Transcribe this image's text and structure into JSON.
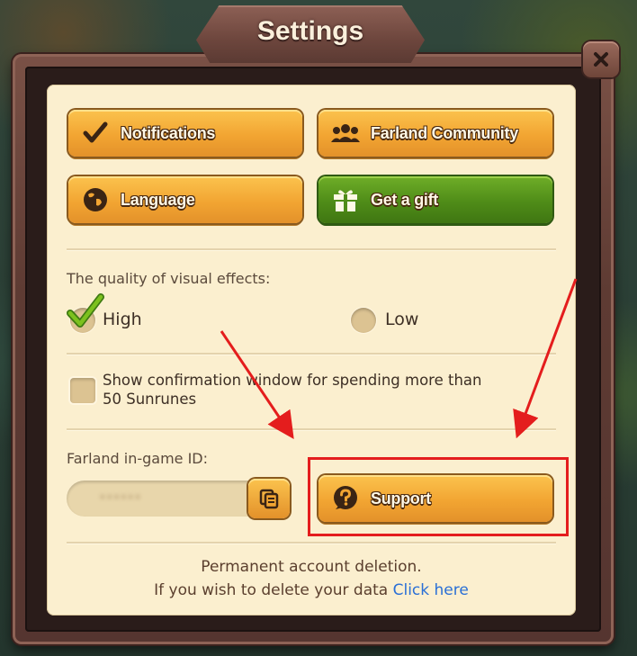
{
  "dialog": {
    "title": "Settings"
  },
  "buttons": {
    "notifications": "Notifications",
    "community": "Farland Community",
    "language": "Language",
    "gift": "Get a gift",
    "support": "Support"
  },
  "visual_quality": {
    "label": "The quality of visual effects:",
    "options": [
      "High",
      "Low"
    ],
    "selected": "High"
  },
  "confirmation": {
    "line1": "Show confirmation window for spending more than",
    "line2": "50 Sunrunes",
    "checked": false
  },
  "game_id": {
    "label": "Farland in-game ID:"
  },
  "footer": {
    "line1": "Permanent account deletion.",
    "line2_prefix": "If you wish to delete your data ",
    "link": "Click here"
  },
  "icons": {
    "close": "close-icon",
    "notifications": "checkmark-icon",
    "community": "people-icon",
    "language": "globe-icon",
    "gift": "gift-icon",
    "copy": "copy-icon",
    "support": "question-icon"
  },
  "colors": {
    "button_orange": "#f2a532",
    "button_green": "#4f8c18",
    "highlight": "#e41d1d",
    "link": "#2a6fd6",
    "panel": "#fbefcf"
  }
}
